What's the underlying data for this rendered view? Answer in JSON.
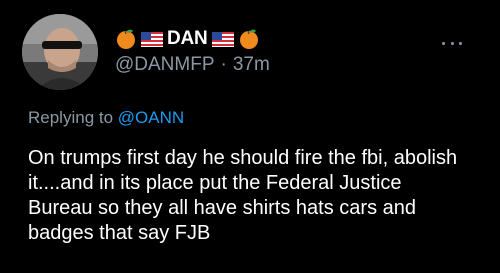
{
  "tweet": {
    "display_name": "DAN",
    "handle": "@DANMFP",
    "separator": "·",
    "time": "37m",
    "reply_prefix": "Replying to",
    "reply_to": "@OANN",
    "text": "On trumps first day he should fire the fbi, abolish\nit....and in its place put the Federal Justice\nBureau so they all have shirts hats cars and\nbadges that say FJB",
    "name_emojis": [
      "orange-emoji",
      "us-flag-emoji",
      "us-flag-emoji",
      "orange-emoji"
    ],
    "more_icon": "more-horizontal-icon"
  },
  "colors": {
    "background": "#000000",
    "primary_text": "#ffffff",
    "secondary_text": "#8b98a5",
    "link": "#1d9bf0",
    "orange": "#f08a1c",
    "leaf": "#3aa14a"
  }
}
